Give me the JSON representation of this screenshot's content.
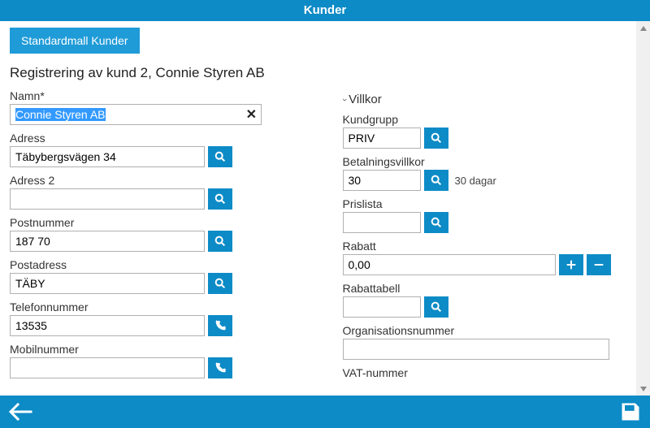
{
  "header": {
    "title": "Kunder"
  },
  "tab": {
    "label": "Standardmall Kunder"
  },
  "page_title": "Registrering av kund 2, Connie Styren AB",
  "left": {
    "namn": {
      "label": "Namn*",
      "value": "Connie Styren AB"
    },
    "adress": {
      "label": "Adress",
      "value": "Täbybergsvägen 34"
    },
    "adress2": {
      "label": "Adress 2",
      "value": ""
    },
    "postnummer": {
      "label": "Postnummer",
      "value": "187 70"
    },
    "postadress": {
      "label": "Postadress",
      "value": "TÄBY"
    },
    "telefon": {
      "label": "Telefonnummer",
      "value": "13535"
    },
    "mobil": {
      "label": "Mobilnummer",
      "value": ""
    }
  },
  "right": {
    "section": "Villkor",
    "kundgrupp": {
      "label": "Kundgrupp",
      "value": "PRIV"
    },
    "betalning": {
      "label": "Betalningsvillkor",
      "value": "30",
      "after": "30 dagar"
    },
    "prislista": {
      "label": "Prislista",
      "value": ""
    },
    "rabatt": {
      "label": "Rabatt",
      "value": "0,00"
    },
    "rabattabell": {
      "label": "Rabattabell",
      "value": ""
    },
    "orgnr": {
      "label": "Organisationsnummer",
      "value": ""
    },
    "vat": {
      "label": "VAT-nummer",
      "value": ""
    }
  }
}
